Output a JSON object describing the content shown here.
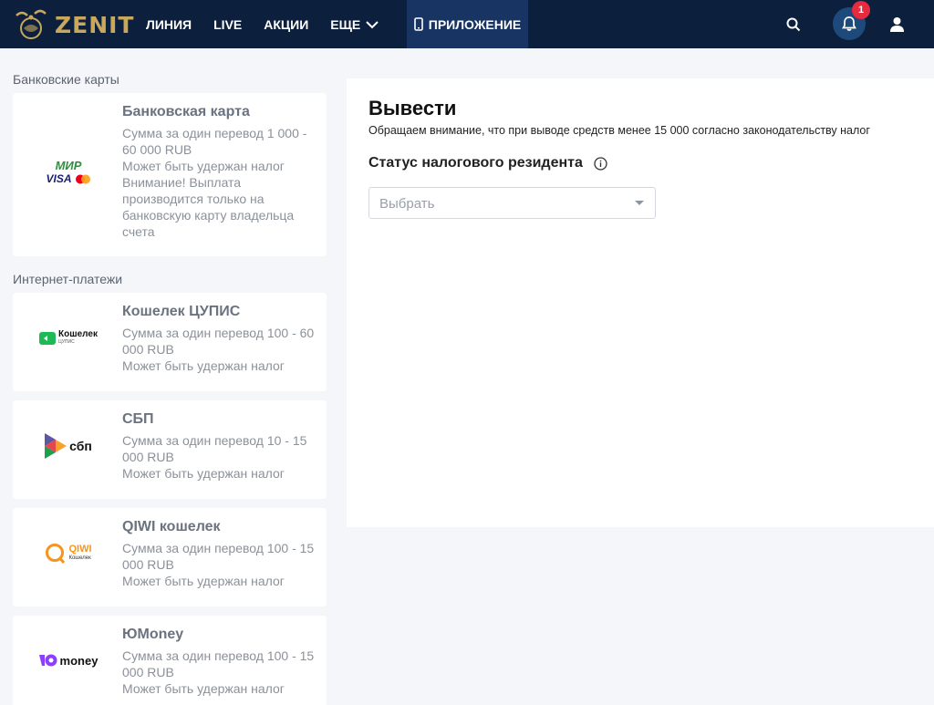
{
  "header": {
    "logo_text": "ZENIT",
    "nav": [
      {
        "label": "ЛИНИЯ"
      },
      {
        "label": "LIVE"
      },
      {
        "label": "АКЦИИ"
      },
      {
        "label": "ЕЩЕ"
      }
    ],
    "app_button": "ПРИЛОЖЕНИЕ",
    "notification_count": "1"
  },
  "sidebar": {
    "sections": [
      {
        "label": "Банковские карты"
      },
      {
        "label": "Интернет-платежи"
      }
    ],
    "methods": [
      {
        "title": "Банковская карта",
        "desc": "Сумма за один перевод 1 000 - 60 000 RUB\nМожет быть удержан налог\nВнимание! Выплата производится только на банковскую карту владельца счета",
        "logo_text_1": "МИР",
        "logo_text_2": "VISA"
      },
      {
        "title": "Кошелек ЦУПИС",
        "desc": "Сумма за один перевод 100 - 60 000 RUB\nМожет быть удержан налог",
        "logo_text_1": "Кошелек",
        "logo_text_2": "ЦУПИС"
      },
      {
        "title": "СБП",
        "desc": "Сумма за один перевод 10 - 15 000 RUB\nМожет быть удержан налог",
        "logo_text_1": "сбп"
      },
      {
        "title": "QIWI кошелек",
        "desc": "Сумма за один перевод 100 - 15 000 RUB\nМожет быть удержан налог",
        "logo_text_1": "QIWI",
        "logo_text_2": "Кошелек"
      },
      {
        "title": "ЮMoney",
        "desc": "Сумма за один перевод 100 - 15 000 RUB\nМожет быть удержан налог",
        "logo_text_1": "money"
      }
    ]
  },
  "main": {
    "title": "Вывести",
    "note": "Обращаем внимание, что при выводе средств менее 15 000 согласно законодательству налог",
    "tax_label": "Статус налогового резидента",
    "select_placeholder": "Выбрать"
  },
  "colors": {
    "header_bg": "#0c1f3c",
    "app_button_bg": "#173463",
    "badge": "#e52b3d",
    "logo_gold": "#c9a85c"
  }
}
